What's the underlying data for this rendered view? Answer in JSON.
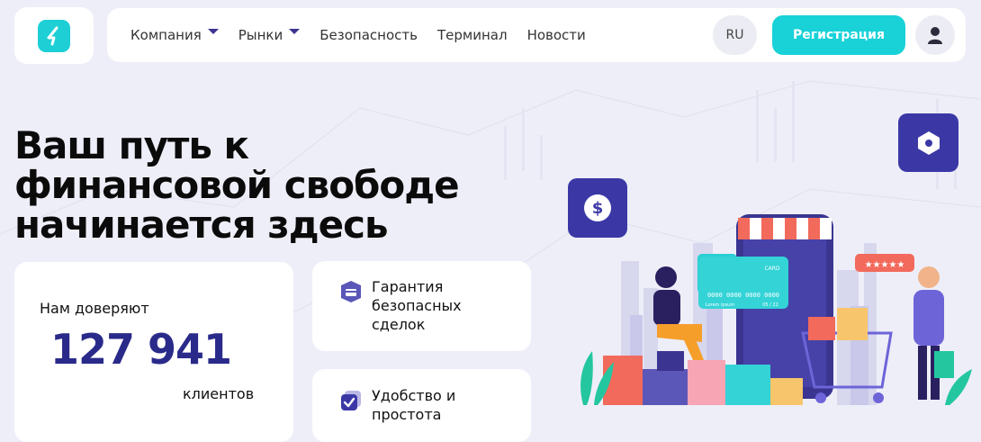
{
  "header": {
    "logo": "logo-icon",
    "nav": [
      {
        "label": "Компания",
        "has_dropdown": true
      },
      {
        "label": "Рынки",
        "has_dropdown": true
      },
      {
        "label": "Безопасность",
        "has_dropdown": false
      },
      {
        "label": "Терминал",
        "has_dropdown": false
      },
      {
        "label": "Новости",
        "has_dropdown": false
      }
    ],
    "language": "RU",
    "register_label": "Регистрация",
    "user_icon": "user-icon"
  },
  "hero": {
    "title_lines": [
      "Ваш путь к",
      "финансовой свободе",
      "начинается здесь"
    ]
  },
  "clients_card": {
    "label": "Нам доверяют",
    "count": "127 941",
    "suffix": "клиентов"
  },
  "features": [
    {
      "icon": "shield-card-icon",
      "lines": [
        "Гарантия",
        "безопасных",
        "сделок"
      ]
    },
    {
      "icon": "checkbox-icon",
      "lines": [
        "Удобство и",
        "простота"
      ]
    }
  ],
  "illustration": {
    "percent_tag": "%",
    "card_number": "0000 0000 0000 0000",
    "card_holder": "Lorem ipsum",
    "card_expiry": "05 / 22",
    "card_label": "CARD",
    "rating_stars": "★★★★★"
  },
  "colors": {
    "accent": "#18d2d8",
    "brand_dark": "#3b38a6",
    "background": "#eeeef8"
  }
}
